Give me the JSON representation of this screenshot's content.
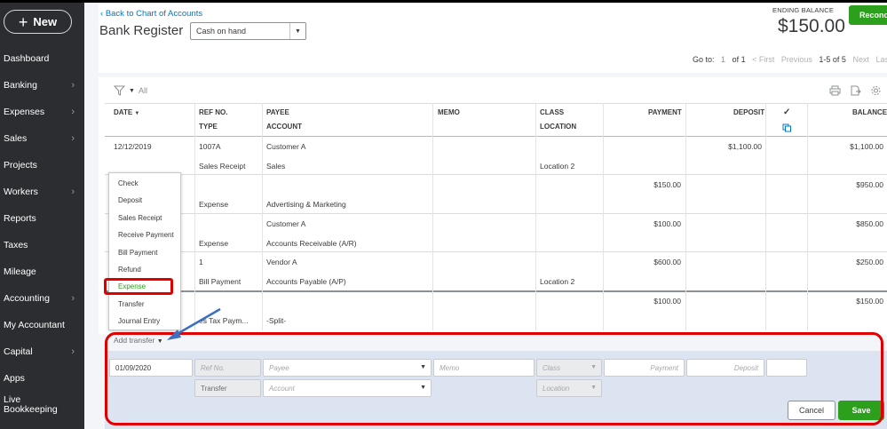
{
  "sidebar": {
    "new_label": "New",
    "items": [
      {
        "label": "Dashboard",
        "chevron": false
      },
      {
        "label": "Banking",
        "chevron": true
      },
      {
        "label": "Expenses",
        "chevron": true
      },
      {
        "label": "Sales",
        "chevron": true
      },
      {
        "label": "Projects",
        "chevron": false
      },
      {
        "label": "Workers",
        "chevron": true
      },
      {
        "label": "Reports",
        "chevron": false
      },
      {
        "label": "Taxes",
        "chevron": false
      },
      {
        "label": "Mileage",
        "chevron": false
      },
      {
        "label": "Accounting",
        "chevron": true
      },
      {
        "label": "My Accountant",
        "chevron": false
      },
      {
        "label": "Capital",
        "chevron": true
      },
      {
        "label": "Apps",
        "chevron": false
      },
      {
        "label": "Live\nBookkeeping",
        "chevron": false
      }
    ]
  },
  "header": {
    "back_link": "Back to Chart of Accounts",
    "title": "Bank Register",
    "account_select": "Cash on hand",
    "ending_balance_label": "ENDING BALANCE",
    "ending_balance_value": "$150.00",
    "reconcile_label": "Reconc"
  },
  "pager": {
    "goto_label": "Go to:",
    "page": "1",
    "of": "of 1",
    "first": "< First",
    "previous": "Previous",
    "range": "1-5 of 5",
    "next": "Next",
    "last": "Last >"
  },
  "filter": {
    "label": "All"
  },
  "columns": {
    "date": "DATE",
    "ref_no": "REF NO.",
    "type": "TYPE",
    "payee": "PAYEE",
    "account": "ACCOUNT",
    "memo": "MEMO",
    "class": "CLASS",
    "location": "LOCATION",
    "payment": "PAYMENT",
    "deposit": "DEPOSIT",
    "check": "✓",
    "balance": "BALANCE"
  },
  "rows": [
    {
      "date": "12/12/2019",
      "ref": "1007A",
      "type": "Sales Receipt",
      "payee": "Customer A",
      "account": "Sales",
      "location": "Location 2",
      "payment": "",
      "deposit": "$1,100.00",
      "balance": "$1,100.00"
    },
    {
      "date": "",
      "ref": "",
      "type": "Expense",
      "payee": "",
      "account": "Advertising & Marketing",
      "location": "",
      "payment": "$150.00",
      "deposit": "",
      "balance": "$950.00"
    },
    {
      "date": "",
      "ref": "",
      "type": "Expense",
      "payee": "Customer A",
      "account": "Accounts Receivable (A/R)",
      "location": "",
      "payment": "$100.00",
      "deposit": "",
      "balance": "$850.00"
    },
    {
      "date": "",
      "ref": "1",
      "type": "Bill Payment",
      "payee": "Vendor A",
      "account": "Accounts Payable (A/P)",
      "location": "Location 2",
      "payment": "$600.00",
      "deposit": "",
      "balance": "$250.00"
    },
    {
      "date": "",
      "ref": "",
      "type": "es Tax Paym...",
      "payee": "",
      "account": "-Split-",
      "location": "",
      "payment": "$100.00",
      "deposit": "",
      "balance": "$150.00"
    }
  ],
  "dropdown": {
    "items": [
      "Check",
      "Deposit",
      "Sales Receipt",
      "Receive Payment",
      "Bill Payment",
      "Refund",
      "Expense",
      "Transfer",
      "Journal Entry"
    ],
    "selected": "Expense",
    "selected_color": "#2ca01c"
  },
  "add_transfer": "Add transfer",
  "form": {
    "date_value": "01/09/2020",
    "ref_placeholder": "Ref No.",
    "payee_placeholder": "Payee",
    "memo_placeholder": "Memo",
    "class_placeholder": "Class",
    "payment_placeholder": "Payment",
    "deposit_placeholder": "Deposit",
    "type_value": "Transfer",
    "account_placeholder": "Account",
    "location_placeholder": "Location",
    "cancel_label": "Cancel",
    "save_label": "Save"
  },
  "colors": {
    "accent_green": "#2ca01c",
    "link_blue": "#0077c5",
    "highlight_red": "#e00000",
    "arrow_blue": "#3d6fc1",
    "sidebar_bg": "#2b2d31"
  }
}
